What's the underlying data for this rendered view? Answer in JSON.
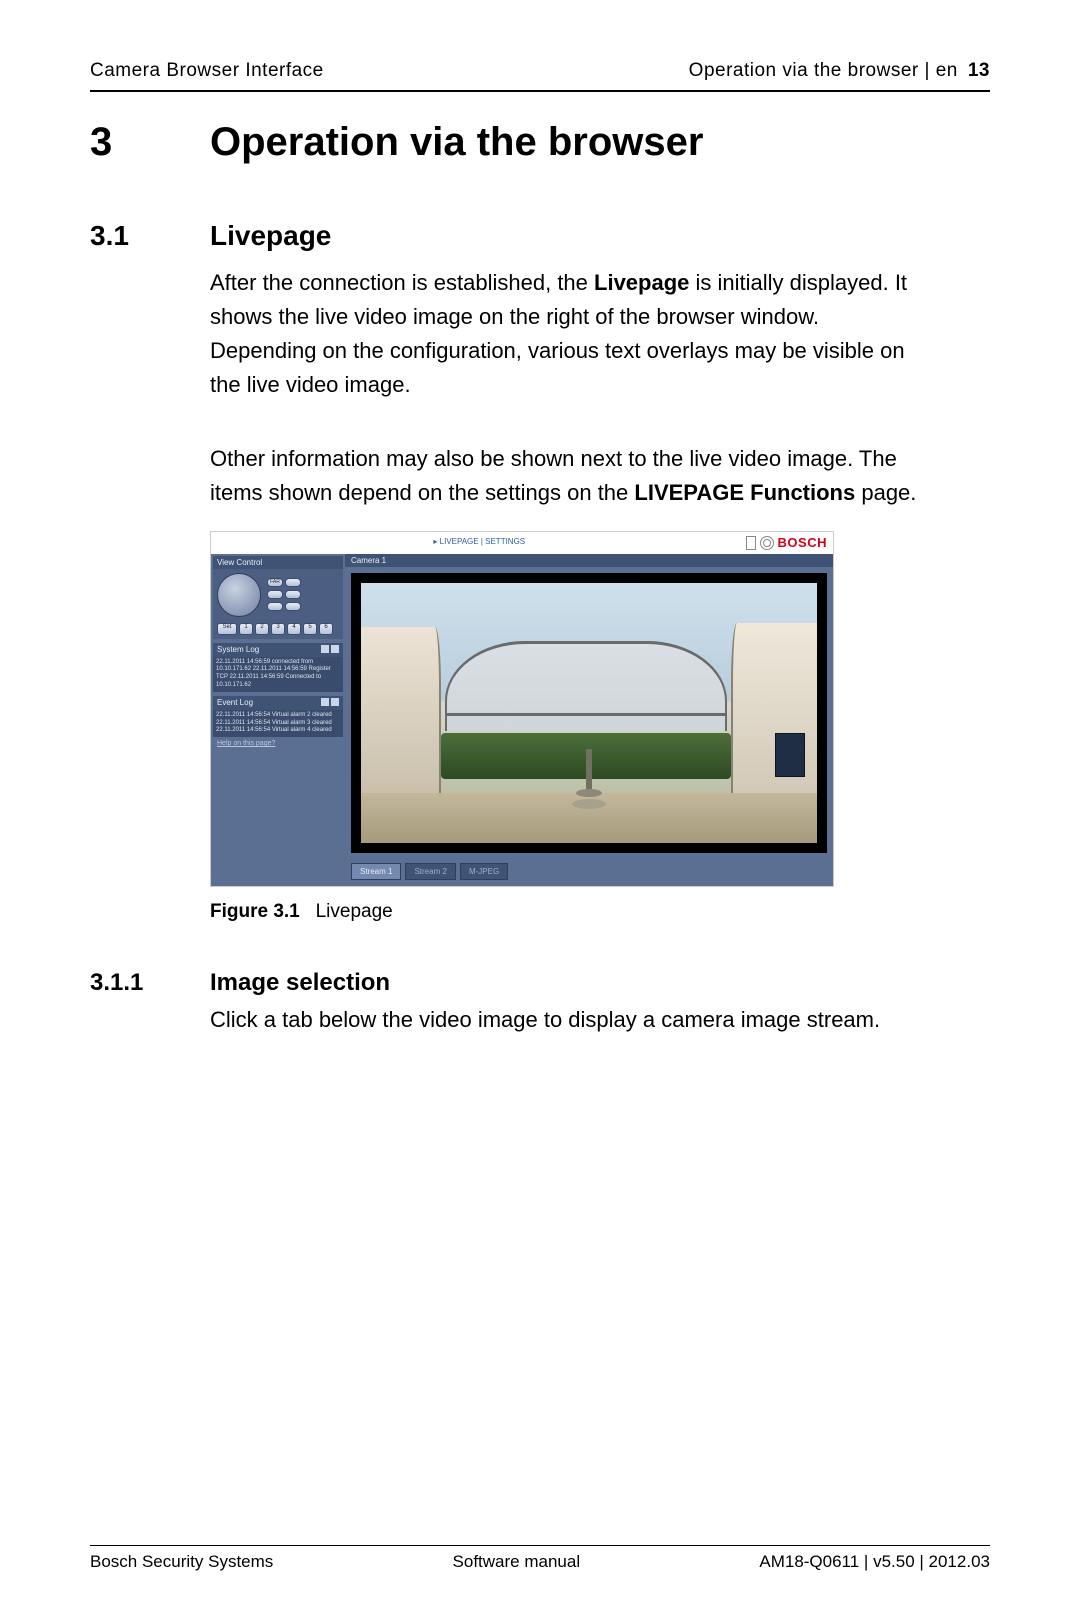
{
  "header": {
    "left": "Camera Browser Interface",
    "right": "Operation via the browser | en",
    "page": "13"
  },
  "chapter": {
    "num": "3",
    "title": "Operation via the browser"
  },
  "section": {
    "num": "3.1",
    "title": "Livepage"
  },
  "para1": {
    "pre": "After the connection is established, the ",
    "strong": "Livepage",
    "post": " is initially displayed. It shows the live video image on the right of the browser window. Depending on the configuration, various text overlays may be visible on the live video image."
  },
  "para2": {
    "pre": "Other information may also be shown next to the live video image. The items shown depend on the settings on the ",
    "strong": "LIVEPAGE Functions",
    "post": " page."
  },
  "figure": {
    "nav_live": "▸ LIVEPAGE",
    "nav_sep": " | ",
    "nav_settings": "SETTINGS",
    "brand": "BOSCH",
    "sidebar": {
      "view_control": "View Control",
      "pill_far": "FAR",
      "set": "Set",
      "presets": [
        "1",
        "2",
        "3",
        "4",
        "5",
        "6"
      ],
      "system_log": "System Log",
      "system_lines": "22.11.2011 14:56:59 connected from 10.10.171.62\n22.11.2011 14:56:59 Register TCP\n22.11.2011 14:56:59 Connected to 10.10.171.62",
      "event_log": "Event Log",
      "event_lines": "22.11.2011 14:56:54 Virtual alarm 2 cleared\n22.11.2011 14:56:54 Virtual alarm 3 cleared\n22.11.2011 14:56:54 Virtual alarm 4 cleared",
      "help": "Help on this page?"
    },
    "camera_label": "Camera 1",
    "tabs": {
      "s1": "Stream 1",
      "s2": "Stream 2",
      "mj": "M-JPEG"
    },
    "caption_label": "Figure 3.1",
    "caption_text": "Livepage"
  },
  "subsection": {
    "num": "3.1.1",
    "title": "Image selection"
  },
  "para3": "Click a tab below the video image to display a camera image stream.",
  "footer": {
    "left": "Bosch Security Systems",
    "center": "Software manual",
    "right": "AM18-Q0611 | v5.50 | 2012.03"
  }
}
